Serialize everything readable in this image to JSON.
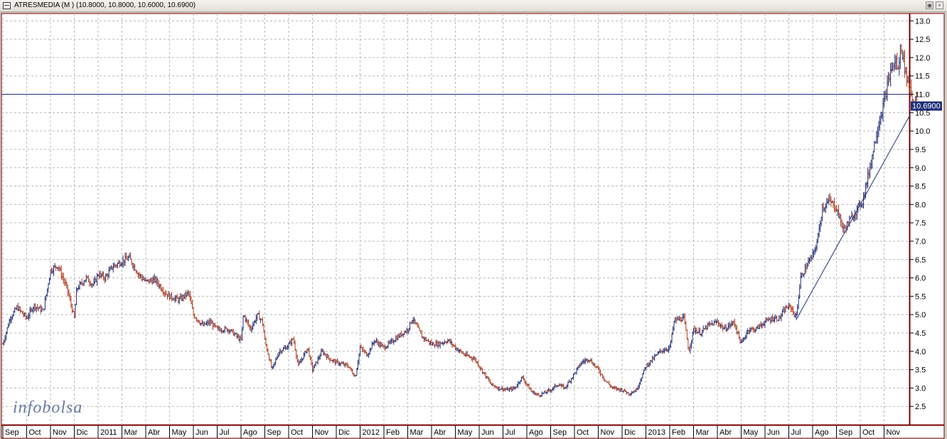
{
  "window": {
    "title": "ATRESMEDIA (M ) (10.8000, 10.8000, 10.6000, 10.6900)",
    "restore_icon": "restore-icon",
    "close_icon": "close-icon"
  },
  "watermark": "infobolsa",
  "chart_data": {
    "type": "ohlc",
    "title": "ATRESMEDIA (M )",
    "ohlc_last": {
      "open": 10.8,
      "high": 10.8,
      "low": 10.6,
      "close": 10.69
    },
    "last_price_label": "10.6900",
    "ylim": [
      2.0,
      13.2
    ],
    "yticks": [
      "13.0",
      "12.5",
      "12.0",
      "11.5",
      "11.0",
      "10.5",
      "10.0",
      "9.5",
      "9.0",
      "8.5",
      "8.0",
      "7.5",
      "7.0",
      "6.5",
      "6.0",
      "5.5",
      "5.0",
      "4.5",
      "4.0",
      "3.5",
      "3.0",
      "2.5"
    ],
    "x_labels": [
      "Sep",
      "Oct",
      "Nov",
      "Dic",
      "2011",
      "Mar",
      "Abr",
      "May",
      "Jun",
      "Jul",
      "Ago",
      "Sep",
      "Oct",
      "Nov",
      "Dic",
      "2012",
      "Feb",
      "Mar",
      "Abr",
      "May",
      "Jun",
      "Jul",
      "Ago",
      "Sep",
      "Oct",
      "Nov",
      "Dic",
      "2013",
      "Feb",
      "Mar",
      "Abr",
      "May",
      "Jun",
      "Jul",
      "Ago",
      "Sep",
      "Oct",
      "Nov"
    ],
    "grid": true,
    "horizontal_line": 11.0,
    "trendline": {
      "from_month": 33.3,
      "from_value": 4.85,
      "to_month": 38.1,
      "to_value": 10.45
    },
    "anchors": [
      [
        0,
        4.2
      ],
      [
        0.3,
        4.9
      ],
      [
        0.6,
        5.2
      ],
      [
        1.0,
        4.9
      ],
      [
        1.3,
        5.25
      ],
      [
        1.7,
        5.1
      ],
      [
        2.0,
        6.2
      ],
      [
        2.3,
        6.35
      ],
      [
        2.7,
        5.7
      ],
      [
        3.0,
        4.9
      ],
      [
        3.1,
        5.7
      ],
      [
        3.5,
        6.0
      ],
      [
        3.8,
        5.8
      ],
      [
        4.0,
        6.1
      ],
      [
        4.3,
        6.0
      ],
      [
        4.6,
        6.3
      ],
      [
        5.0,
        6.45
      ],
      [
        5.3,
        6.55
      ],
      [
        5.7,
        6.1
      ],
      [
        6.0,
        5.9
      ],
      [
        6.4,
        5.95
      ],
      [
        6.8,
        5.6
      ],
      [
        7.0,
        5.5
      ],
      [
        7.4,
        5.4
      ],
      [
        7.8,
        5.6
      ],
      [
        8.0,
        5.0
      ],
      [
        8.4,
        4.7
      ],
      [
        8.7,
        4.8
      ],
      [
        9.0,
        4.6
      ],
      [
        9.5,
        4.6
      ],
      [
        10.0,
        4.3
      ],
      [
        10.1,
        5.0
      ],
      [
        10.4,
        4.6
      ],
      [
        10.7,
        5.0
      ],
      [
        10.9,
        4.8
      ],
      [
        11.0,
        4.3
      ],
      [
        11.3,
        3.5
      ],
      [
        11.6,
        4.0
      ],
      [
        11.9,
        4.1
      ],
      [
        12.2,
        4.35
      ],
      [
        12.4,
        3.6
      ],
      [
        12.8,
        4.1
      ],
      [
        13.0,
        3.5
      ],
      [
        13.4,
        4.0
      ],
      [
        13.7,
        3.8
      ],
      [
        14.0,
        3.7
      ],
      [
        14.5,
        3.6
      ],
      [
        14.8,
        3.3
      ],
      [
        15.0,
        4.1
      ],
      [
        15.3,
        3.9
      ],
      [
        15.6,
        4.3
      ],
      [
        16.0,
        4.1
      ],
      [
        16.5,
        4.35
      ],
      [
        17.0,
        4.6
      ],
      [
        17.2,
        4.9
      ],
      [
        17.6,
        4.4
      ],
      [
        18.0,
        4.2
      ],
      [
        18.3,
        4.2
      ],
      [
        18.7,
        4.3
      ],
      [
        19.0,
        4.1
      ],
      [
        19.4,
        3.9
      ],
      [
        19.8,
        3.8
      ],
      [
        20.2,
        3.4
      ],
      [
        20.5,
        3.1
      ],
      [
        20.8,
        3.0
      ],
      [
        21.2,
        2.95
      ],
      [
        21.5,
        3.0
      ],
      [
        21.8,
        3.3
      ],
      [
        22.2,
        2.9
      ],
      [
        22.5,
        2.8
      ],
      [
        23.0,
        2.95
      ],
      [
        23.3,
        3.1
      ],
      [
        23.6,
        3.0
      ],
      [
        24.0,
        3.4
      ],
      [
        24.3,
        3.7
      ],
      [
        24.6,
        3.8
      ],
      [
        25.0,
        3.5
      ],
      [
        25.3,
        3.2
      ],
      [
        25.6,
        3.0
      ],
      [
        26.0,
        2.95
      ],
      [
        26.3,
        2.85
      ],
      [
        26.6,
        2.95
      ],
      [
        27.0,
        3.6
      ],
      [
        27.3,
        3.8
      ],
      [
        27.6,
        4.0
      ],
      [
        28.0,
        4.1
      ],
      [
        28.2,
        4.85
      ],
      [
        28.6,
        4.9
      ],
      [
        28.8,
        4.0
      ],
      [
        29.0,
        4.6
      ],
      [
        29.3,
        4.5
      ],
      [
        29.6,
        4.7
      ],
      [
        30.0,
        4.8
      ],
      [
        30.3,
        4.6
      ],
      [
        30.7,
        4.8
      ],
      [
        31.0,
        4.2
      ],
      [
        31.3,
        4.6
      ],
      [
        31.6,
        4.6
      ],
      [
        32.0,
        4.8
      ],
      [
        32.3,
        4.9
      ],
      [
        32.6,
        4.9
      ],
      [
        32.9,
        5.2
      ],
      [
        33.1,
        5.2
      ],
      [
        33.3,
        4.9
      ],
      [
        33.5,
        6.0
      ],
      [
        33.8,
        6.4
      ],
      [
        34.0,
        6.6
      ],
      [
        34.2,
        7.0
      ],
      [
        34.4,
        7.9
      ],
      [
        34.7,
        8.1
      ],
      [
        35.0,
        7.9
      ],
      [
        35.3,
        7.3
      ],
      [
        35.6,
        7.6
      ],
      [
        35.8,
        7.8
      ],
      [
        36.1,
        8.1
      ],
      [
        36.4,
        9.0
      ],
      [
        36.7,
        10.0
      ],
      [
        37.0,
        10.8
      ],
      [
        37.3,
        11.7
      ],
      [
        37.5,
        11.9
      ],
      [
        37.6,
        11.6
      ],
      [
        37.7,
        12.4
      ],
      [
        37.9,
        11.6
      ],
      [
        38.1,
        11.2
      ],
      [
        38.2,
        10.8
      ],
      [
        38.3,
        10.9
      ],
      [
        38.4,
        10.69
      ]
    ]
  }
}
